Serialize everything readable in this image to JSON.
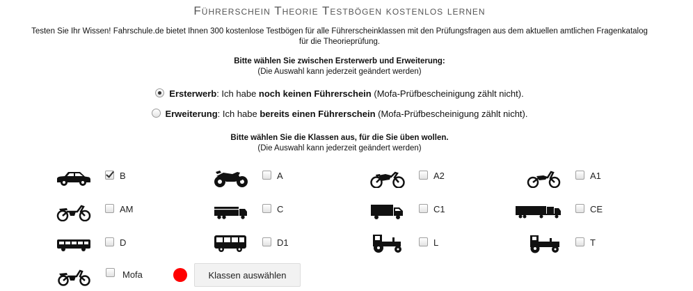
{
  "page": {
    "title": "Führerschein Theorie Testbögen kostenlos lernen",
    "intro_line1": "Testen Sie Ihr Wissen! Fahrschule.de bietet Ihnen 300 kostenlose Testbögen für alle Führerscheinklassen mit den Prüfungsfragen aus dem aktuellen amtlichen Fragenkatalog",
    "intro_line2": "für die Theorieprüfung."
  },
  "choice": {
    "heading": "Bitte wählen Sie zwischen Ersterwerb und Erweiterung:",
    "note": "(Die Auswahl kann jederzeit geändert werden)",
    "options": [
      {
        "name": "Ersterwerb",
        "text1": ": Ich habe ",
        "bold": "noch keinen Führerschein",
        "text2": " (Mofa-Prüfbescheinigung zählt nicht).",
        "selected": true
      },
      {
        "name": "Erweiterung",
        "text1": ": Ich habe ",
        "bold": "bereits einen Führerschein",
        "text2": " (Mofa-Prüfbescheinigung zählt nicht).",
        "selected": false
      }
    ]
  },
  "classes": {
    "heading": "Bitte wählen Sie die Klassen aus, für die Sie üben wollen.",
    "note": "(Die Auswahl kann jederzeit geändert werden)",
    "items": [
      {
        "label": "B",
        "icon": "car-icon",
        "checked": true
      },
      {
        "label": "A",
        "icon": "motorcycle-icon",
        "checked": false
      },
      {
        "label": "A2",
        "icon": "motorcycle-icon",
        "checked": false
      },
      {
        "label": "A1",
        "icon": "motorcycle-icon",
        "checked": false
      },
      {
        "label": "AM",
        "icon": "moped-icon",
        "checked": false
      },
      {
        "label": "C",
        "icon": "truck-icon",
        "checked": false
      },
      {
        "label": "C1",
        "icon": "truck-icon",
        "checked": false
      },
      {
        "label": "CE",
        "icon": "truck-trailer-icon",
        "checked": false
      },
      {
        "label": "D",
        "icon": "bus-icon",
        "checked": false
      },
      {
        "label": "D1",
        "icon": "bus-icon",
        "checked": false
      },
      {
        "label": "L",
        "icon": "tractor-icon",
        "checked": false
      },
      {
        "label": "T",
        "icon": "tractor-icon",
        "checked": false
      },
      {
        "label": "Mofa",
        "icon": "moped-icon",
        "checked": false
      }
    ]
  },
  "actions": {
    "submit_label": "Klassen auswählen",
    "status_color": "#ff0000"
  }
}
